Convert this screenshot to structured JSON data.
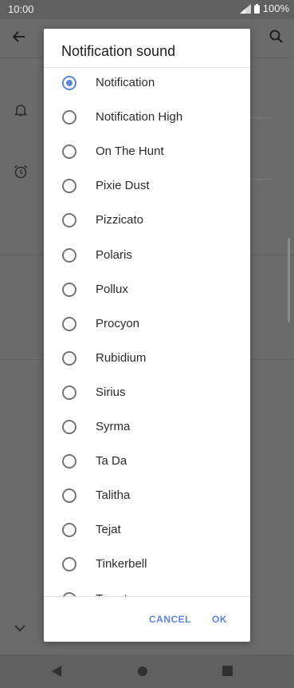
{
  "status_bar": {
    "time": "10:00",
    "battery": "100%"
  },
  "dialog": {
    "title": "Notification sound",
    "selected_index": 0,
    "options": [
      {
        "label": "Notification"
      },
      {
        "label": "Notification High"
      },
      {
        "label": "On The Hunt"
      },
      {
        "label": "Pixie Dust"
      },
      {
        "label": "Pizzicato"
      },
      {
        "label": "Polaris"
      },
      {
        "label": "Pollux"
      },
      {
        "label": "Procyon"
      },
      {
        "label": "Rubidium"
      },
      {
        "label": "Sirius"
      },
      {
        "label": "Syrma"
      },
      {
        "label": "Ta Da"
      },
      {
        "label": "Talitha"
      },
      {
        "label": "Tejat"
      },
      {
        "label": "Tinkerbell"
      },
      {
        "label": "Tweet"
      }
    ],
    "cancel_label": "CANCEL",
    "ok_label": "OK"
  },
  "colors": {
    "accent": "#5b86e5",
    "scrim": "#6b6b6b"
  },
  "icons": [
    "back-arrow-icon",
    "search-icon",
    "bell-icon",
    "alarm-clock-icon",
    "chevron-down-icon",
    "signal-icon",
    "battery-icon",
    "nav-back-icon",
    "nav-home-icon",
    "nav-recents-icon"
  ]
}
